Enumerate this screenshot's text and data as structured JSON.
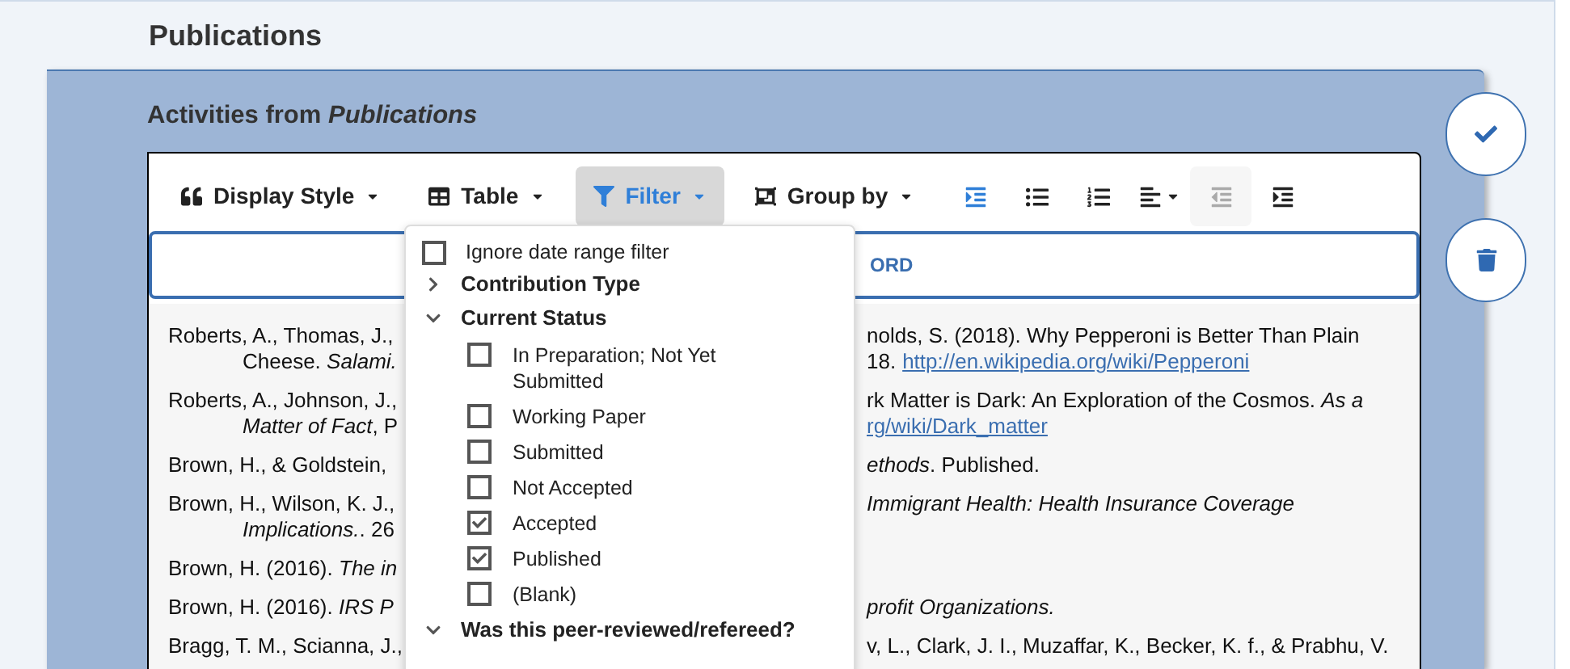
{
  "page_title": "Publications",
  "panel": {
    "title": "Activities from *Publications*"
  },
  "toolbar": {
    "menus": [
      {
        "label": "Display Style",
        "selected": false
      },
      {
        "label": "Table",
        "selected": false
      },
      {
        "label": "Filter",
        "selected": true
      },
      {
        "label": "Group by",
        "selected": false
      }
    ],
    "icon_buttons": [
      {
        "selected": true,
        "disabled": false
      },
      {
        "selected": false,
        "disabled": false
      },
      {
        "selected": false,
        "disabled": false
      },
      {
        "selected": false,
        "disabled": false
      },
      {
        "selected": false,
        "disabled": true
      },
      {
        "selected": false,
        "disabled": false
      }
    ]
  },
  "keyword_bar": {
    "text": "ORD"
  },
  "citations": [
    {
      "left": [
        "Roberts, A., Thomas, J.,",
        "Cheese. *Salami.*"
      ],
      "right": [
        {
          "text": "nolds, S. (2018). Why Pepperoni is Better Than Plain"
        },
        {
          "text": "18.",
          "link": "http://en.wikipedia.org/wiki/Pepperoni"
        }
      ]
    },
    {
      "left": [
        "Roberts, A., Johnson, J.,",
        "*Matter of Fact*, P"
      ],
      "right": [
        {
          "text": "rk Matter is Dark: An Exploration of the Cosmos. *As a*"
        },
        {
          "link": "rg/wiki/Dark_matter"
        }
      ]
    },
    {
      "left": [
        "Brown, H., & Goldstein,"
      ],
      "right": [
        {
          "text": "*ethods*. Published."
        }
      ]
    },
    {
      "left": [
        "Brown, H., Wilson, K. J.,",
        "*Implications.*. 26"
      ],
      "right": [
        {
          "text": "*Immigrant Health: Health Insurance Coverage*"
        }
      ]
    },
    {
      "left": [
        "Brown, H. (2016). *The in*"
      ]
    },
    {
      "left": [
        "Brown, H. (2016). *IRS P*"
      ],
      "right": [
        {
          "text": "*profit Organizations.*"
        }
      ]
    },
    {
      "left": [
        "Bragg, T. M., Scianna, J.,"
      ],
      "right": [
        {
          "text": "v, L., Clark, J. I., Muzaffar, K., Becker, K. f., & Prabhu, V."
        }
      ]
    }
  ],
  "filter_menu": {
    "ignore_date": {
      "label": "Ignore date range filter",
      "checked": false
    },
    "groups": [
      {
        "label": "Contribution Type",
        "expanded": false
      },
      {
        "label": "Current Status",
        "expanded": true,
        "children": [
          {
            "label": "In Preparation; Not Yet Submitted",
            "checked": false
          },
          {
            "label": "Working Paper",
            "checked": false
          },
          {
            "label": "Submitted",
            "checked": false
          },
          {
            "label": "Not Accepted",
            "checked": false
          },
          {
            "label": "Accepted",
            "checked": true
          },
          {
            "label": "Published",
            "checked": true
          },
          {
            "label": "(Blank)",
            "checked": false
          }
        ]
      },
      {
        "label": "Was this peer-reviewed/refereed?",
        "expanded": true
      }
    ]
  }
}
